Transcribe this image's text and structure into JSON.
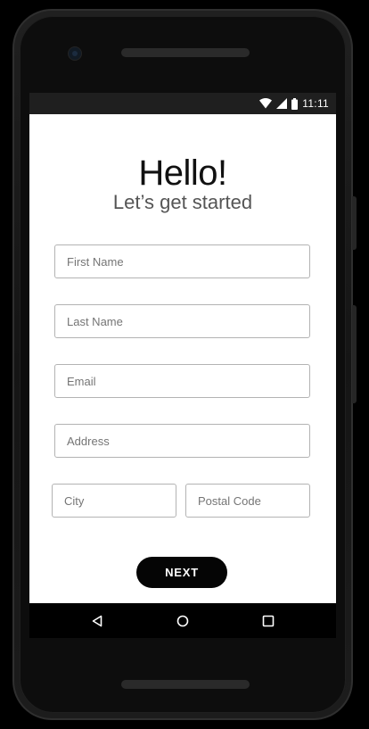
{
  "status_bar": {
    "time": "11:11",
    "icons": [
      "wifi-icon",
      "cellular-signal-icon",
      "battery-icon"
    ]
  },
  "header": {
    "title": "Hello!",
    "subtitle": "Let’s get started"
  },
  "form": {
    "first_name_placeholder": "First Name",
    "last_name_placeholder": "Last Name",
    "email_placeholder": "Email",
    "address_placeholder": "Address",
    "city_placeholder": "City",
    "postal_code_placeholder": "Postal Code",
    "next_label": "NEXT"
  },
  "nav_bar": {
    "buttons": [
      "back-icon",
      "home-icon",
      "recent-apps-icon"
    ]
  },
  "colors": {
    "button_background": "#050505",
    "button_text": "#ffffff",
    "field_border": "#b3b3b3",
    "status_bar": "#1f1f1f",
    "nav_bar": "#000000"
  }
}
